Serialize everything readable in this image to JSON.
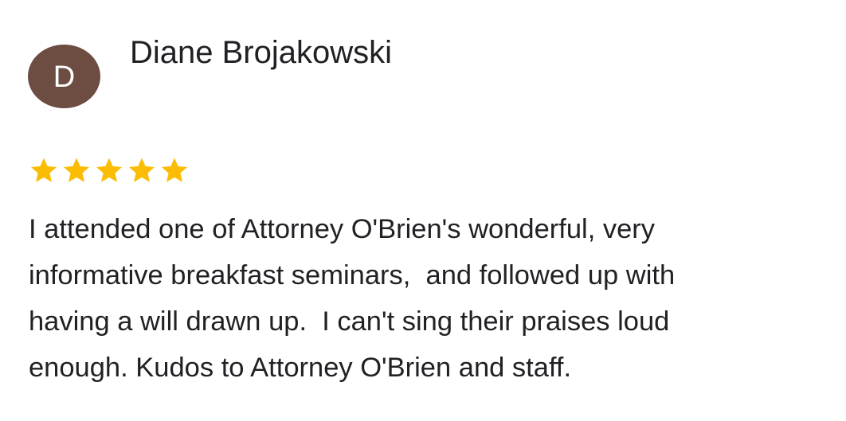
{
  "review": {
    "avatar_initial": "D",
    "avatar_color": "#6d4c41",
    "reviewer_name": "Diane Brojakowski",
    "rating": 5,
    "rating_max": 5,
    "star_color": "#fbbc04",
    "star_icon": "star-icon",
    "text_lines": [
      "I attended one of Attorney O'Brien's wonderful, very",
      "informative breakfast seminars,  and followed up with",
      "having a will drawn up.  I can't sing their praises loud",
      "enough. Kudos to Attorney O'Brien and staff."
    ]
  }
}
